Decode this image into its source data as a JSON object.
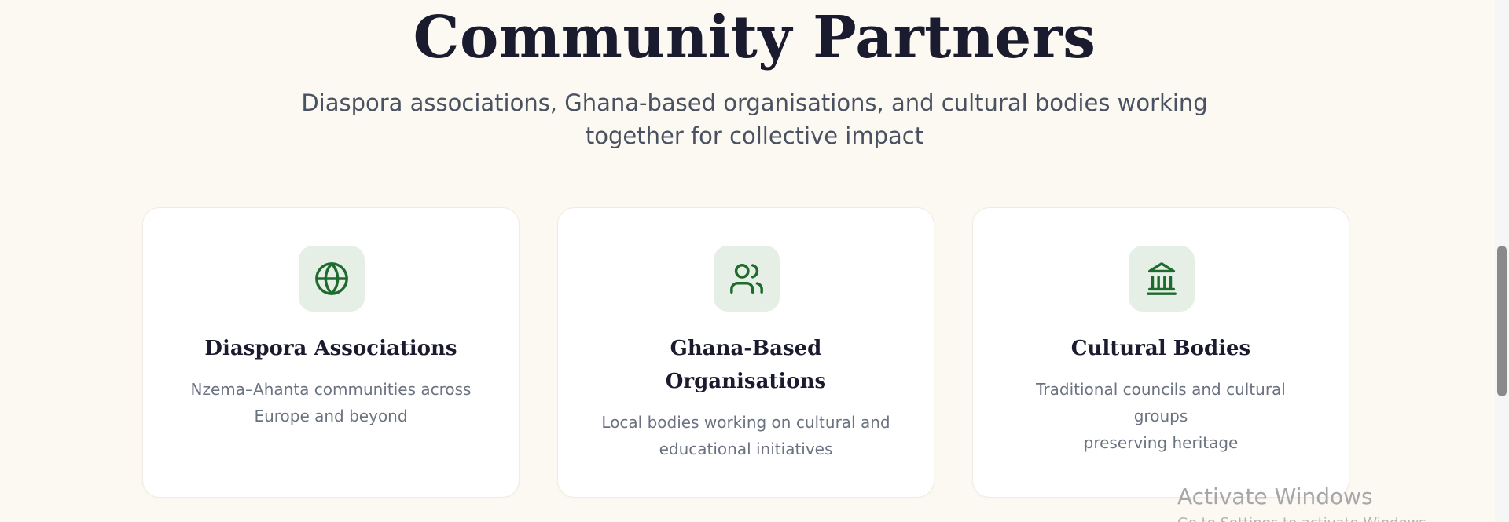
{
  "section": {
    "title": "Community Partners",
    "subtitle_line1": "Diaspora associations, Ghana-based organisations, and cultural bodies working",
    "subtitle_line2": "together for collective impact"
  },
  "cards": [
    {
      "icon": "globe-icon",
      "title": "Diaspora Associations",
      "desc_line1": "Nzema–Ahanta communities across",
      "desc_line2": "Europe and beyond"
    },
    {
      "icon": "users-icon",
      "title_line1": "Ghana-Based",
      "title_line2": "Organisations",
      "desc_line1": "Local bodies working on cultural and",
      "desc_line2": "educational initiatives"
    },
    {
      "icon": "landmark-icon",
      "title": "Cultural Bodies",
      "desc_line1": "Traditional councils and cultural groups",
      "desc_line2": "preserving heritage"
    }
  ],
  "overlay": {
    "watermark": "Activate Windows",
    "watermark_sub": "Go to Settings to activate Windows."
  },
  "colors": {
    "background": "#fcf8f2",
    "accent_green": "#1f6b2e",
    "icon_bg": "#e6efe6",
    "heading": "#1b1b2f"
  }
}
